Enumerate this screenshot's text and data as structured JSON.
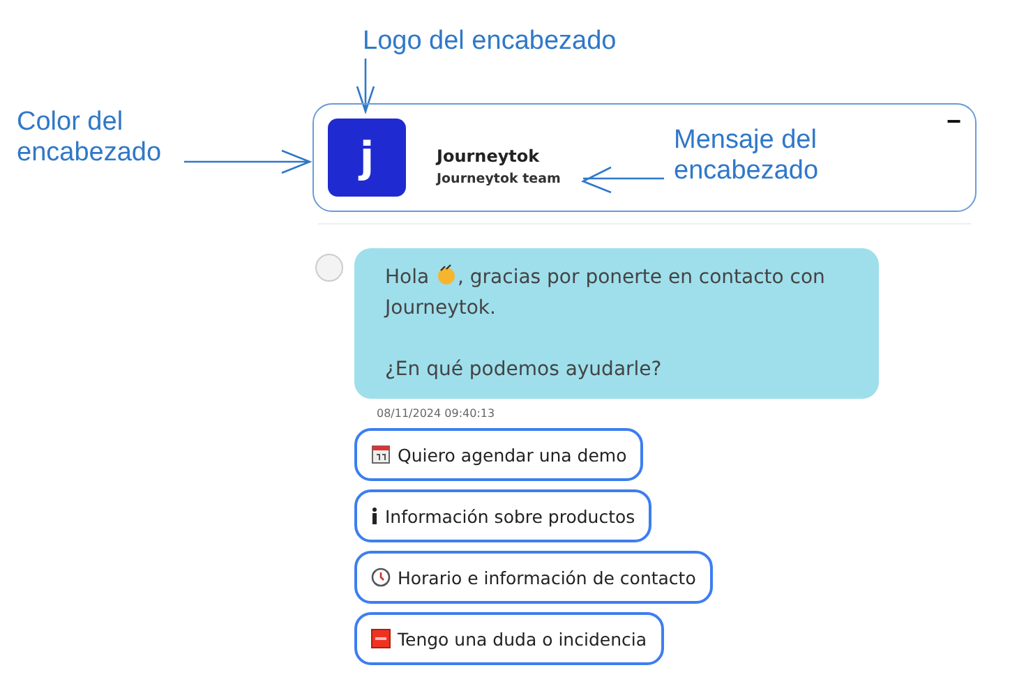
{
  "annotations": [
    {
      "kind": "logo",
      "text": "Logo del encabezado"
    },
    {
      "kind": "color",
      "text": "Color del encabezado"
    },
    {
      "kind": "message",
      "text": "Mensaje del encabezado"
    }
  ],
  "header": {
    "logo": "j",
    "title": "Journeytok",
    "subtitle": "Journeytok team",
    "minimize": "−"
  },
  "message": {
    "greeting": "Hola",
    "greeting_rest": ", gracias por ponerte en contacto con Journeytok.",
    "question": "¿En qué podemos ayudarle?",
    "timestamp": "08/11/2024 09:40:13"
  },
  "options": [
    {
      "kind": "calendar",
      "label": "Quiero agendar una demo"
    },
    {
      "kind": "info",
      "label": "Información sobre productos"
    },
    {
      "kind": "clock",
      "label": "Horario e información de contacto"
    },
    {
      "kind": "sos",
      "label": "Tengo una duda o incidencia"
    }
  ]
}
